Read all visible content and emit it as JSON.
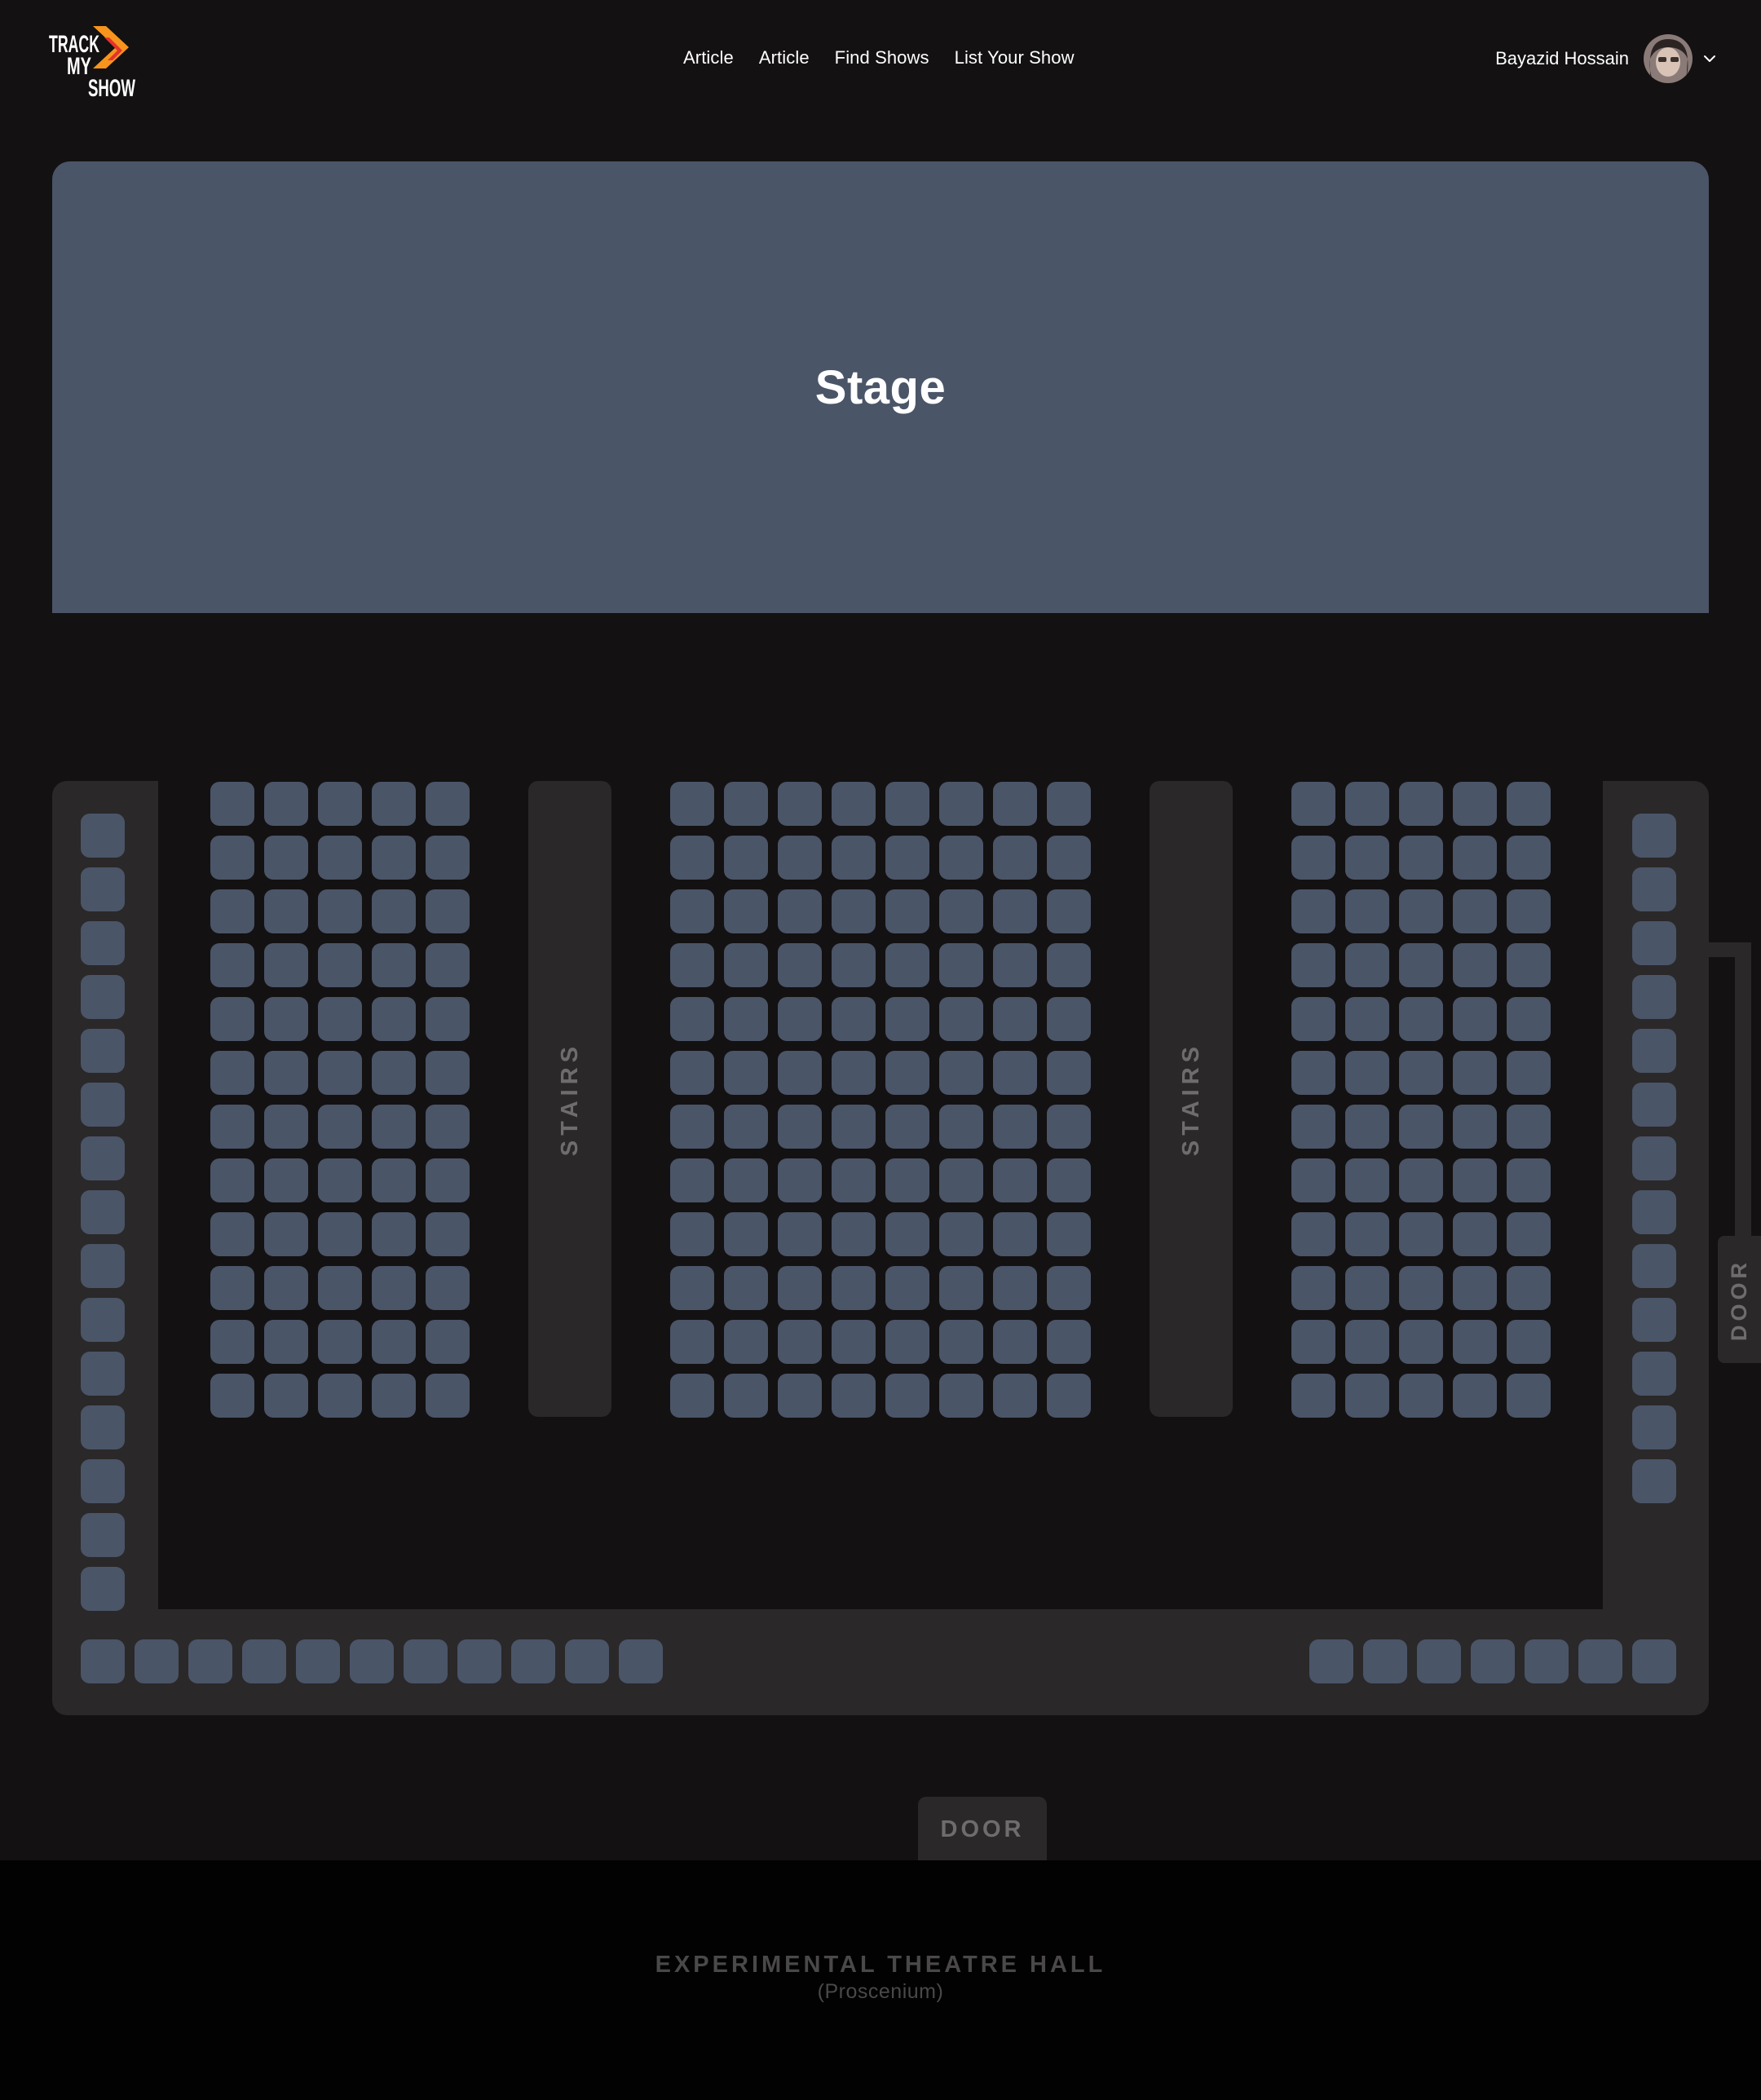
{
  "header": {
    "logo_text": [
      "TRACK",
      "MY",
      "SHOW"
    ],
    "nav": [
      "Article",
      "Article",
      "Find Shows",
      "List Your Show"
    ],
    "user_name": "Bayazid Hossain"
  },
  "stage": {
    "label": "Stage"
  },
  "hall": {
    "stairs_label": "STAIRS",
    "side_door_label": "DOOR",
    "bottom_door_label": "DOOR",
    "seat_color": "#4b5568",
    "blocks": {
      "left": {
        "rows": 12,
        "cols": 5
      },
      "center": {
        "rows": 12,
        "cols": 8
      },
      "right": {
        "rows": 12,
        "cols": 5
      }
    },
    "side_columns": {
      "left_seats": 15,
      "right_seats": 13
    },
    "bottom_row": {
      "left_seats": 11,
      "right_seats": 7
    }
  },
  "footer": {
    "hall_name": "EXPERIMENTAL THEATRE HALL",
    "hall_type": "(Proscenium)"
  },
  "colors": {
    "background": "#131112",
    "stage": "#4b5568",
    "structure": "#2a2829",
    "footer": "#020202",
    "logo_accent": "#f7941d"
  }
}
